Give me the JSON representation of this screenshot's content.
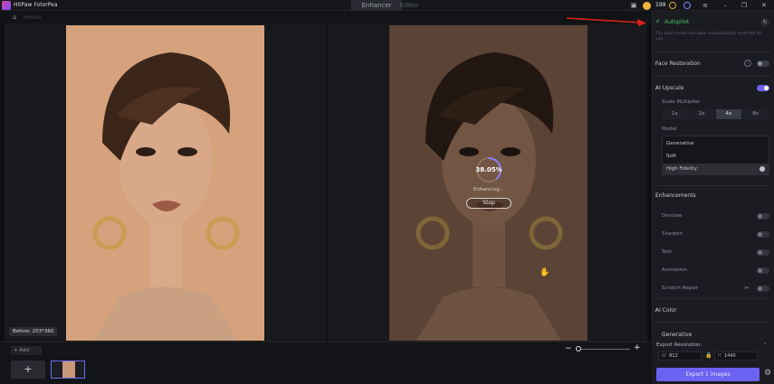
{
  "app": {
    "title": "HitPaw FotorPea"
  },
  "tabs": [
    {
      "label": "Enhancer"
    },
    {
      "label": "Editor"
    }
  ],
  "toolbar": {
    "credits": "199"
  },
  "home": {
    "label": "Home"
  },
  "preview": {
    "before_badge": "Before: 203*360",
    "progress": "38.05%",
    "progress_value": 38.05,
    "status": "Enhancing...",
    "stop_label": "Stop"
  },
  "bottom": {
    "add_label": "+ Add",
    "add_tile": "+"
  },
  "panel": {
    "autopilot": "Autopilot",
    "autopilot_note": "The best model has been automatically matched for you.",
    "face_restoration": "Face Restoration",
    "ai_upscale": "AI Upscale",
    "scale_multiplier": "Scale Multiplier",
    "scales": [
      "1x",
      "2x",
      "4x",
      "8x"
    ],
    "scale_selected": "4x",
    "model_label": "Model",
    "models": [
      "Generative",
      "Soft",
      "High Fidelity"
    ],
    "model_selected": "High Fidelity",
    "enhancements": "Enhancements",
    "features": [
      "Denoise",
      "Sharpen",
      "Text",
      "Animation",
      "Scratch Repair"
    ],
    "ai_color": "AI Color",
    "generative": "Generative"
  },
  "export": {
    "label": "Export Resolution:",
    "w_label": "W",
    "width": "812",
    "h_label": "H",
    "height": "1440",
    "button": "Export 1 images"
  },
  "colors": {
    "accent": "#6b62f2",
    "autopilot": "#4dc46b",
    "arrow": "#e0201e"
  }
}
